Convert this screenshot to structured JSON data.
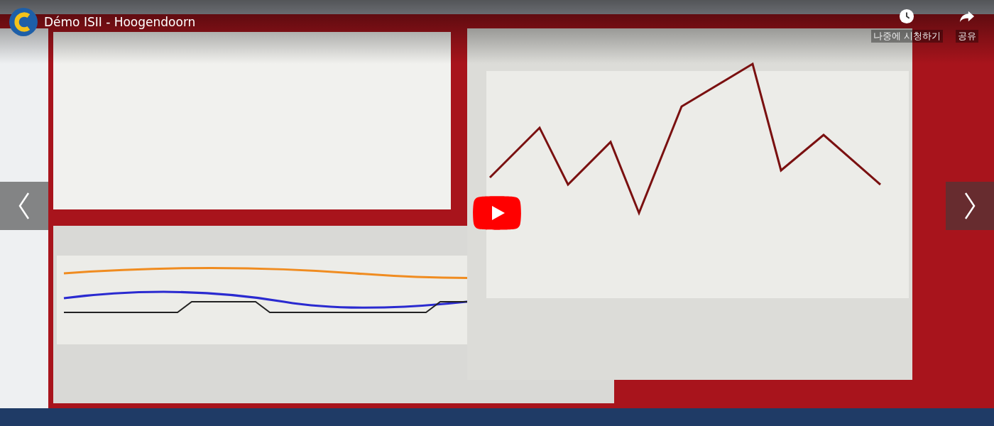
{
  "title": "Démo ISII - Hoogendoorn",
  "actions": [
    {
      "kind": "watch_later",
      "label": "나중에 시청하기"
    },
    {
      "kind": "share",
      "label": "공유"
    }
  ]
}
